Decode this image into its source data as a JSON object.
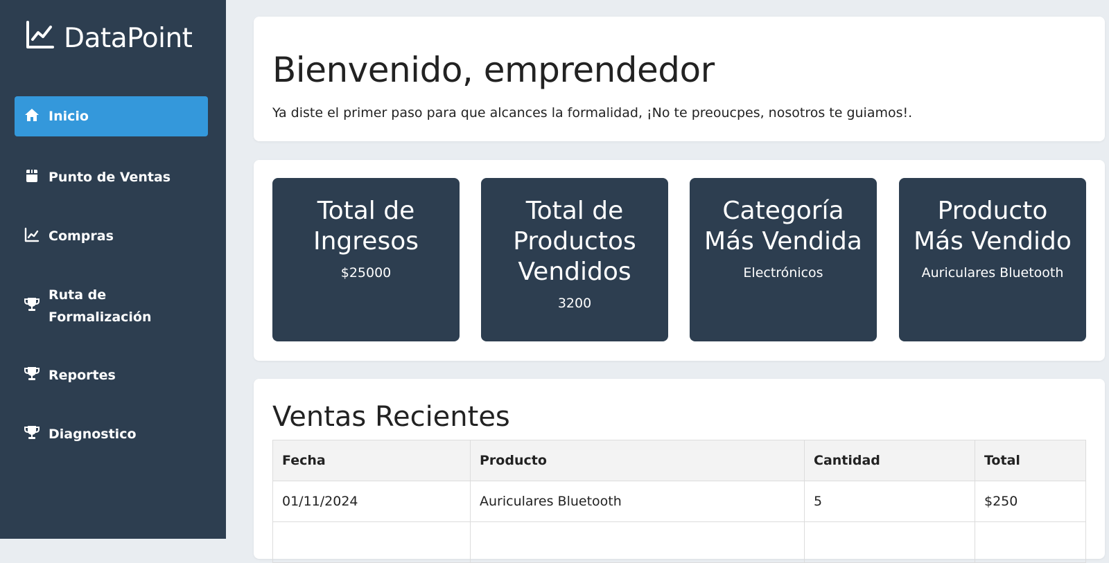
{
  "brand": {
    "name": "DataPoint",
    "icon": "line-chart-icon"
  },
  "sidebar": {
    "items": [
      {
        "label": "Inicio",
        "icon": "home-icon",
        "active": true
      },
      {
        "label": "Punto de Ventas",
        "icon": "box-icon",
        "active": false
      },
      {
        "label": "Compras",
        "icon": "line-chart-icon",
        "active": false
      },
      {
        "label": "Ruta de Formalización",
        "icon": "trophy-icon",
        "active": false
      },
      {
        "label": "Reportes",
        "icon": "trophy-icon",
        "active": false
      },
      {
        "label": "Diagnostico",
        "icon": "trophy-icon",
        "active": false
      }
    ]
  },
  "welcome": {
    "title": "Bienvenido, emprendedor",
    "subtitle": "Ya diste el primer paso para que alcances la formalidad, ¡No te preoucpes, nosotros te guiamos!."
  },
  "stats": [
    {
      "title": "Total de Ingresos",
      "value": "$25000"
    },
    {
      "title": "Total de Productos Vendidos",
      "value": "3200"
    },
    {
      "title": "Categoría Más Vendida",
      "value": "Electrónicos"
    },
    {
      "title": "Producto Más Vendido",
      "value": "Auriculares Bluetooth"
    }
  ],
  "recent": {
    "title": "Ventas Recientes",
    "headers": [
      "Fecha",
      "Producto",
      "Cantidad",
      "Total"
    ],
    "rows": [
      [
        "01/11/2024",
        "Auriculares Bluetooth",
        "5",
        "$250"
      ]
    ]
  },
  "colors": {
    "sidebar": "#2d3e50",
    "active": "#3498db",
    "background": "#e9edf1",
    "card": "#ffffff"
  }
}
